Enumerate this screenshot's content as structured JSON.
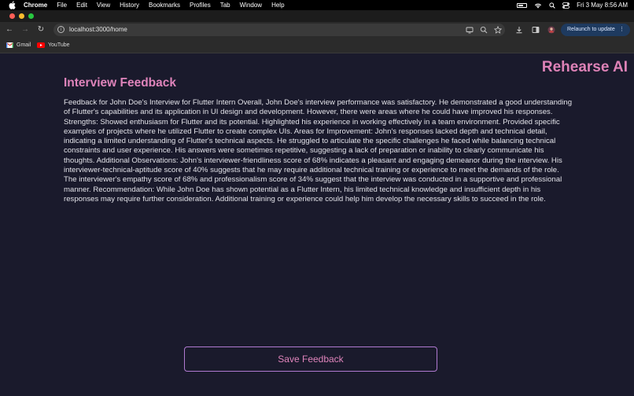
{
  "menubar": {
    "app": "Chrome",
    "menus": [
      "File",
      "Edit",
      "View",
      "History",
      "Bookmarks",
      "Profiles",
      "Tab",
      "Window",
      "Help"
    ],
    "clock": "Fri 3 May  8:56 AM"
  },
  "browser": {
    "url": "localhost:3000/home",
    "relaunch_label": "Relaunch to update",
    "bookmarks": [
      {
        "label": "Gmail",
        "icon": "gmail-icon"
      },
      {
        "label": "YouTube",
        "icon": "youtube-icon"
      }
    ],
    "colors": {
      "close": "#ff5f57",
      "minimize": "#febc2e",
      "maximize": "#28c840"
    }
  },
  "page": {
    "brand": "Rehearse AI",
    "title": "Interview Feedback",
    "feedback_text": "Feedback for John Doe's Interview for Flutter Intern Overall, John Doe's interview performance was satisfactory. He demonstrated a good understanding of Flutter's capabilities and its application in UI design and development. However, there were areas where he could have improved his responses. Strengths: Showed enthusiasm for Flutter and its potential. Highlighted his experience in working effectively in a team environment. Provided specific examples of projects where he utilized Flutter to create complex UIs. Areas for Improvement: John's responses lacked depth and technical detail, indicating a limited understanding of Flutter's technical aspects. He struggled to articulate the specific challenges he faced while balancing technical constraints and user experience. His answers were sometimes repetitive, suggesting a lack of preparation or inability to clearly communicate his thoughts. Additional Observations: John's interviewer-friendliness score of 68% indicates a pleasant and engaging demeanor during the interview. His interviewer-technical-aptitude score of 40% suggests that he may require additional technical training or experience to meet the demands of the role. The interviewer's empathy score of 68% and professionalism score of 34% suggest that the interview was conducted in a supportive and professional manner. Recommendation: While John Doe has shown potential as a Flutter Intern, his limited technical knowledge and insufficient depth in his responses may require further consideration. Additional training or experience could help him develop the necessary skills to succeed in the role.",
    "save_label": "Save Feedback",
    "colors": {
      "accent": "#df84bb",
      "button_border": "#b07ad1",
      "background": "#1a1a2c"
    }
  }
}
